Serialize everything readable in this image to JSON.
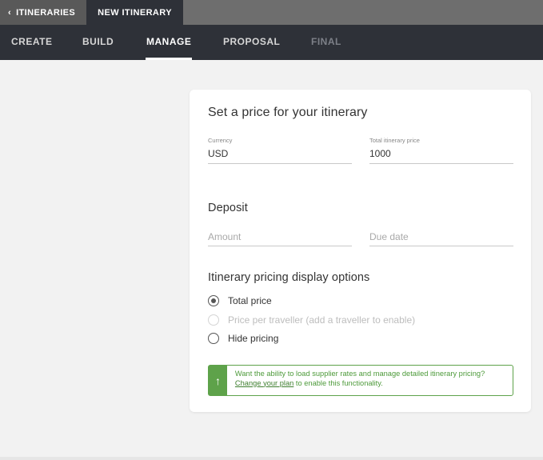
{
  "topbar": {
    "back_chevron": "‹",
    "back_label": "ITINERARIES",
    "current_label": "NEW ITINERARY"
  },
  "nav": {
    "tabs": [
      {
        "label": "CREATE",
        "state": "normal"
      },
      {
        "label": "BUILD",
        "state": "normal"
      },
      {
        "label": "MANAGE",
        "state": "active"
      },
      {
        "label": "PROPOSAL",
        "state": "normal"
      },
      {
        "label": "FINAL",
        "state": "disabled"
      }
    ]
  },
  "price_section": {
    "title": "Set a price for your itinerary",
    "currency_label": "Currency",
    "currency_value": "USD",
    "total_label": "Total itinerary price",
    "total_value": "1000"
  },
  "deposit_section": {
    "title": "Deposit",
    "amount_placeholder": "Amount",
    "due_date_placeholder": "Due date"
  },
  "display_options": {
    "title": "Itinerary pricing display options",
    "options": [
      {
        "label": "Total price",
        "checked": true,
        "disabled": false
      },
      {
        "label": "Price per traveller (add a traveller to enable)",
        "checked": false,
        "disabled": true
      },
      {
        "label": "Hide pricing",
        "checked": false,
        "disabled": false
      }
    ]
  },
  "upgrade_notice": {
    "icon": "arrow-up-icon",
    "text_before": "Want the ability to load supplier rates and manage detailed itinerary pricing? ",
    "link_text": "Change your plan",
    "text_after": " to enable this functionality."
  },
  "colors": {
    "nav_bg": "#2e3138",
    "topbar_bg": "#6e6e6e",
    "accent_green": "#5ea24a"
  }
}
